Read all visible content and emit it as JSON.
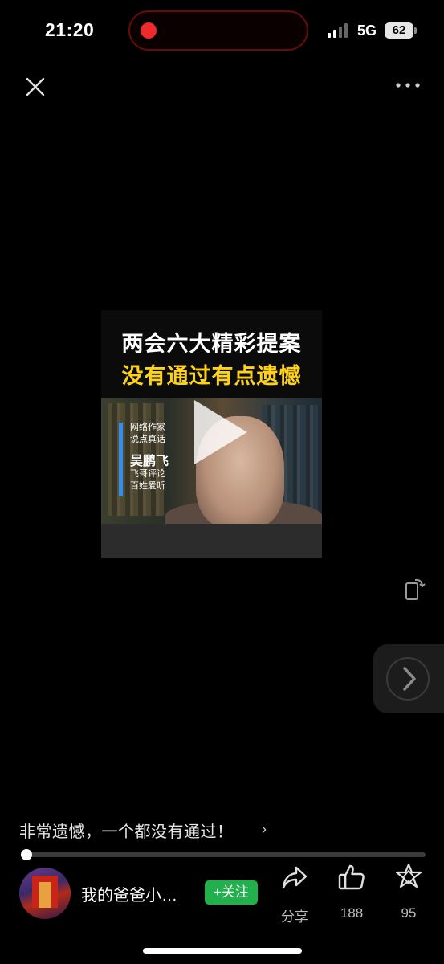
{
  "status_bar": {
    "time": "21:20",
    "network": "5G",
    "battery": "62"
  },
  "video": {
    "title_line1": "两会六大精彩提案",
    "title_line2": "没有通过有点遗憾",
    "side_label_top": "网络作家",
    "side_label_top2": "说点真话",
    "side_label_name": "吴鹏飞",
    "side_label_bottom": "飞哥评论",
    "side_label_bottom2": "百姓爱听"
  },
  "caption": {
    "text": "非常遗憾，一个都没有通过！",
    "chevron": "›"
  },
  "progress": {
    "fraction": 0.01
  },
  "author": {
    "name": "我的爸爸小…",
    "follow_label": "+关注"
  },
  "actions": {
    "share_label": "分享",
    "like_count": "188",
    "favorite_count": "95"
  },
  "colors": {
    "accent_green": "#21b04b",
    "title_yellow": "#ffd21a",
    "record_red": "#ee2a2a"
  }
}
